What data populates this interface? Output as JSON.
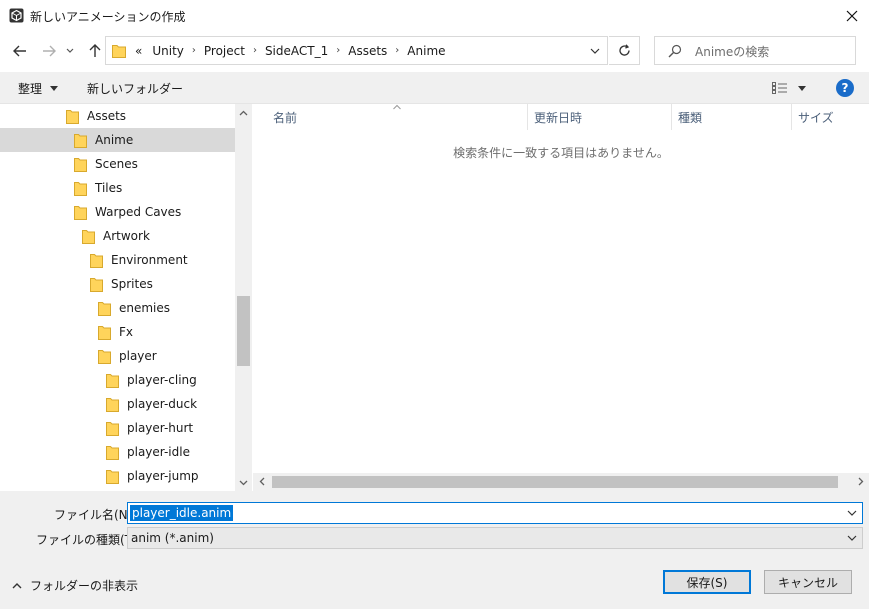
{
  "window": {
    "title": "新しいアニメーションの作成",
    "close_label": "✕"
  },
  "address": {
    "overflow": "«",
    "crumbs": [
      "Unity",
      "Project",
      "SideACT_1",
      "Assets",
      "Anime"
    ]
  },
  "search": {
    "placeholder": "Animeの検索"
  },
  "toolbar": {
    "organize_label": "整理",
    "new_folder_label": "新しいフォルダー",
    "help_label": "?"
  },
  "nav": {
    "items": [
      {
        "label": "Assets",
        "indent": 0,
        "selected": false
      },
      {
        "label": "Anime",
        "indent": 1,
        "selected": true
      },
      {
        "label": "Scenes",
        "indent": 1,
        "selected": false
      },
      {
        "label": "Tiles",
        "indent": 1,
        "selected": false
      },
      {
        "label": "Warped Caves",
        "indent": 1,
        "selected": false
      },
      {
        "label": "Artwork",
        "indent": 2,
        "selected": false
      },
      {
        "label": "Environment",
        "indent": 3,
        "selected": false
      },
      {
        "label": "Sprites",
        "indent": 3,
        "selected": false
      },
      {
        "label": "enemies",
        "indent": 4,
        "selected": false
      },
      {
        "label": "Fx",
        "indent": 4,
        "selected": false
      },
      {
        "label": "player",
        "indent": 4,
        "selected": false
      },
      {
        "label": "player-cling",
        "indent": 5,
        "selected": false
      },
      {
        "label": "player-duck",
        "indent": 5,
        "selected": false
      },
      {
        "label": "player-hurt",
        "indent": 5,
        "selected": false
      },
      {
        "label": "player-idle",
        "indent": 5,
        "selected": false
      },
      {
        "label": "player-jump",
        "indent": 5,
        "selected": false
      }
    ]
  },
  "filelist": {
    "columns": [
      "名前",
      "更新日時",
      "種類",
      "サイズ"
    ],
    "empty_message": "検索条件に一致する項目はありません。"
  },
  "filename": {
    "label": "ファイル名(N):",
    "value": "player_idle.anim"
  },
  "filetype": {
    "label": "ファイルの種類(T):",
    "value": "anim (*.anim)"
  },
  "footer": {
    "hide_folders_label": "フォルダーの非表示",
    "save_label": "保存(S)",
    "cancel_label": "キャンセル"
  },
  "colors": {
    "accent": "#0078d7",
    "folder": "#ffd45b",
    "help": "#1a6cc9"
  }
}
